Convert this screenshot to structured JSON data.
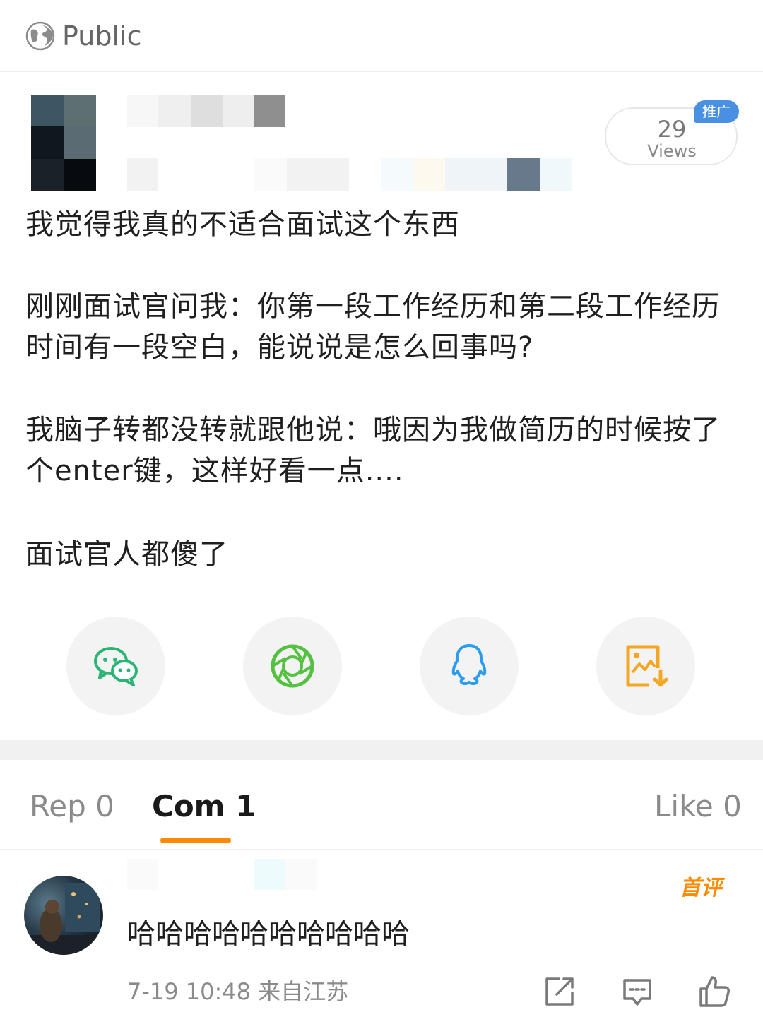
{
  "header": {
    "visibility_label": "Public",
    "visibility_icon": "globe-icon"
  },
  "post": {
    "views_count": "29",
    "views_label": "Views",
    "promo_tag": "推广",
    "paragraphs": [
      "我觉得我真的不适合面试这个东西",
      "刚刚面试官问我：你第一段工作经历和第二段工作经历时间有一段空白，能说说是怎么回事吗?",
      "我脑子转都没转就跟他说：哦因为我做简历的时候按了个enter键，这样好看一点....",
      "面试官人都傻了"
    ]
  },
  "share": {
    "buttons": [
      {
        "name": "wechat",
        "icon": "wechat-icon",
        "color": "#2ab574"
      },
      {
        "name": "moments",
        "icon": "moments-icon",
        "color": "#55c142"
      },
      {
        "name": "qq",
        "icon": "qq-icon",
        "color": "#2b9cf0"
      },
      {
        "name": "save-image",
        "icon": "save-image-icon",
        "color": "#f5a623"
      }
    ]
  },
  "tabs": {
    "repost": "Rep 0",
    "comments": "Com 1",
    "likes": "Like 0",
    "active": "comments",
    "accent_color": "#ff8a00"
  },
  "comment": {
    "badge": "首评",
    "text": "哈哈哈哈哈哈哈哈哈哈",
    "time": "7-19 10:48",
    "location": "来自江苏",
    "actions": [
      "share-icon",
      "reply-icon",
      "like-icon"
    ]
  }
}
